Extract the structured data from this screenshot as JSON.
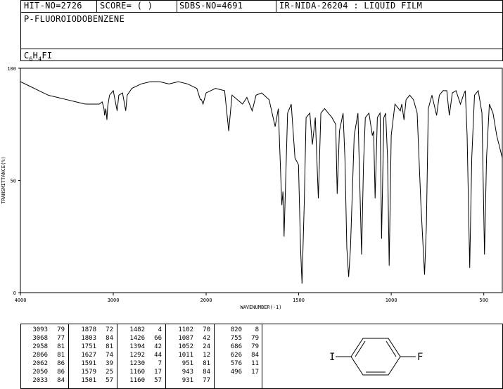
{
  "header": {
    "hit_no": "HIT-NO=2726",
    "score": "SCORE=  (   )",
    "sdbs_no": "SDBS-NO=4691",
    "ir_nida": "IR-NIDA-26204 : LIQUID FILM"
  },
  "compound": {
    "name": "P-FLUOROIODOBENZENE",
    "formula_c": "C",
    "formula_c_sub": "6",
    "formula_h": "H",
    "formula_h_sub": "4",
    "formula_rest": "FI"
  },
  "chart_data": {
    "type": "line",
    "xlabel": "WAVENUMBER(-1)",
    "ylabel": "TRANSMITTANCE(%)",
    "xlim": [
      4000,
      400
    ],
    "ylim": [
      0,
      100
    ],
    "x_ticks": [
      "4000",
      "3000",
      "2000",
      "1500",
      "1000",
      "500"
    ],
    "y_ticks": [
      "100",
      "50",
      "0"
    ],
    "grid": false,
    "series": [
      {
        "values": [
          [
            4000,
            94
          ],
          [
            3900,
            92
          ],
          [
            3800,
            90
          ],
          [
            3700,
            88
          ],
          [
            3600,
            87
          ],
          [
            3500,
            86
          ],
          [
            3400,
            85
          ],
          [
            3300,
            84
          ],
          [
            3200,
            84
          ],
          [
            3150,
            84
          ],
          [
            3120,
            85
          ],
          [
            3100,
            82
          ],
          [
            3093,
            79
          ],
          [
            3080,
            82
          ],
          [
            3068,
            77
          ],
          [
            3060,
            83
          ],
          [
            3040,
            88
          ],
          [
            3000,
            90
          ],
          [
            2958,
            81
          ],
          [
            2940,
            88
          ],
          [
            2900,
            89
          ],
          [
            2866,
            81
          ],
          [
            2850,
            88
          ],
          [
            2800,
            91
          ],
          [
            2700,
            93
          ],
          [
            2600,
            94
          ],
          [
            2500,
            94
          ],
          [
            2400,
            93
          ],
          [
            2300,
            94
          ],
          [
            2200,
            93
          ],
          [
            2100,
            91
          ],
          [
            2062,
            86
          ],
          [
            2050,
            86
          ],
          [
            2033,
            84
          ],
          [
            2000,
            89
          ],
          [
            1950,
            91
          ],
          [
            1900,
            90
          ],
          [
            1878,
            72
          ],
          [
            1860,
            88
          ],
          [
            1803,
            84
          ],
          [
            1780,
            87
          ],
          [
            1751,
            81
          ],
          [
            1730,
            88
          ],
          [
            1700,
            89
          ],
          [
            1660,
            86
          ],
          [
            1627,
            74
          ],
          [
            1610,
            82
          ],
          [
            1591,
            39
          ],
          [
            1585,
            45
          ],
          [
            1579,
            25
          ],
          [
            1560,
            80
          ],
          [
            1540,
            84
          ],
          [
            1520,
            60
          ],
          [
            1501,
            57
          ],
          [
            1490,
            20
          ],
          [
            1482,
            4
          ],
          [
            1470,
            40
          ],
          [
            1460,
            78
          ],
          [
            1440,
            80
          ],
          [
            1426,
            66
          ],
          [
            1410,
            78
          ],
          [
            1394,
            42
          ],
          [
            1380,
            80
          ],
          [
            1360,
            82
          ],
          [
            1340,
            80
          ],
          [
            1320,
            78
          ],
          [
            1300,
            75
          ],
          [
            1292,
            44
          ],
          [
            1280,
            72
          ],
          [
            1260,
            80
          ],
          [
            1250,
            60
          ],
          [
            1240,
            20
          ],
          [
            1230,
            7
          ],
          [
            1220,
            20
          ],
          [
            1200,
            70
          ],
          [
            1180,
            80
          ],
          [
            1160,
            17
          ],
          [
            1150,
            57
          ],
          [
            1140,
            78
          ],
          [
            1120,
            80
          ],
          [
            1102,
            70
          ],
          [
            1095,
            72
          ],
          [
            1087,
            42
          ],
          [
            1075,
            78
          ],
          [
            1060,
            80
          ],
          [
            1052,
            24
          ],
          [
            1040,
            78
          ],
          [
            1030,
            80
          ],
          [
            1020,
            60
          ],
          [
            1011,
            12
          ],
          [
            1000,
            70
          ],
          [
            980,
            84
          ],
          [
            951,
            81
          ],
          [
            943,
            84
          ],
          [
            931,
            77
          ],
          [
            920,
            86
          ],
          [
            900,
            88
          ],
          [
            880,
            86
          ],
          [
            860,
            80
          ],
          [
            840,
            40
          ],
          [
            820,
            8
          ],
          [
            810,
            30
          ],
          [
            800,
            82
          ],
          [
            780,
            88
          ],
          [
            755,
            79
          ],
          [
            740,
            88
          ],
          [
            720,
            90
          ],
          [
            700,
            90
          ],
          [
            686,
            79
          ],
          [
            670,
            89
          ],
          [
            650,
            90
          ],
          [
            626,
            84
          ],
          [
            610,
            88
          ],
          [
            600,
            90
          ],
          [
            590,
            70
          ],
          [
            576,
            11
          ],
          [
            565,
            60
          ],
          [
            550,
            88
          ],
          [
            530,
            90
          ],
          [
            510,
            80
          ],
          [
            496,
            17
          ],
          [
            485,
            60
          ],
          [
            470,
            84
          ],
          [
            450,
            80
          ],
          [
            430,
            70
          ],
          [
            400,
            60
          ]
        ]
      }
    ]
  },
  "peak_table": {
    "columns": [
      [
        [
          "3093",
          "79"
        ],
        [
          "3068",
          "77"
        ],
        [
          "2958",
          "81"
        ],
        [
          "2866",
          "81"
        ],
        [
          "2062",
          "86"
        ],
        [
          "2050",
          "86"
        ],
        [
          "2033",
          "84"
        ]
      ],
      [
        [
          "1878",
          "72"
        ],
        [
          "1803",
          "84"
        ],
        [
          "1751",
          "81"
        ],
        [
          "1627",
          "74"
        ],
        [
          "1591",
          "39"
        ],
        [
          "1579",
          "25"
        ],
        [
          "1501",
          "57"
        ]
      ],
      [
        [
          "1482",
          "4"
        ],
        [
          "1426",
          "66"
        ],
        [
          "1394",
          "42"
        ],
        [
          "1292",
          "44"
        ],
        [
          "1230",
          "7"
        ],
        [
          "1160",
          "17"
        ],
        [
          "1160",
          "57"
        ]
      ],
      [
        [
          "1102",
          "70"
        ],
        [
          "1087",
          "42"
        ],
        [
          "1052",
          "24"
        ],
        [
          "1011",
          "12"
        ],
        [
          "951",
          "81"
        ],
        [
          "943",
          "84"
        ],
        [
          "931",
          "77"
        ]
      ],
      [
        [
          "820",
          "8"
        ],
        [
          "755",
          "79"
        ],
        [
          "686",
          "79"
        ],
        [
          "626",
          "84"
        ],
        [
          "576",
          "11"
        ],
        [
          "496",
          "17"
        ]
      ]
    ]
  },
  "structure": {
    "left_atom": "I",
    "right_atom": "F"
  }
}
